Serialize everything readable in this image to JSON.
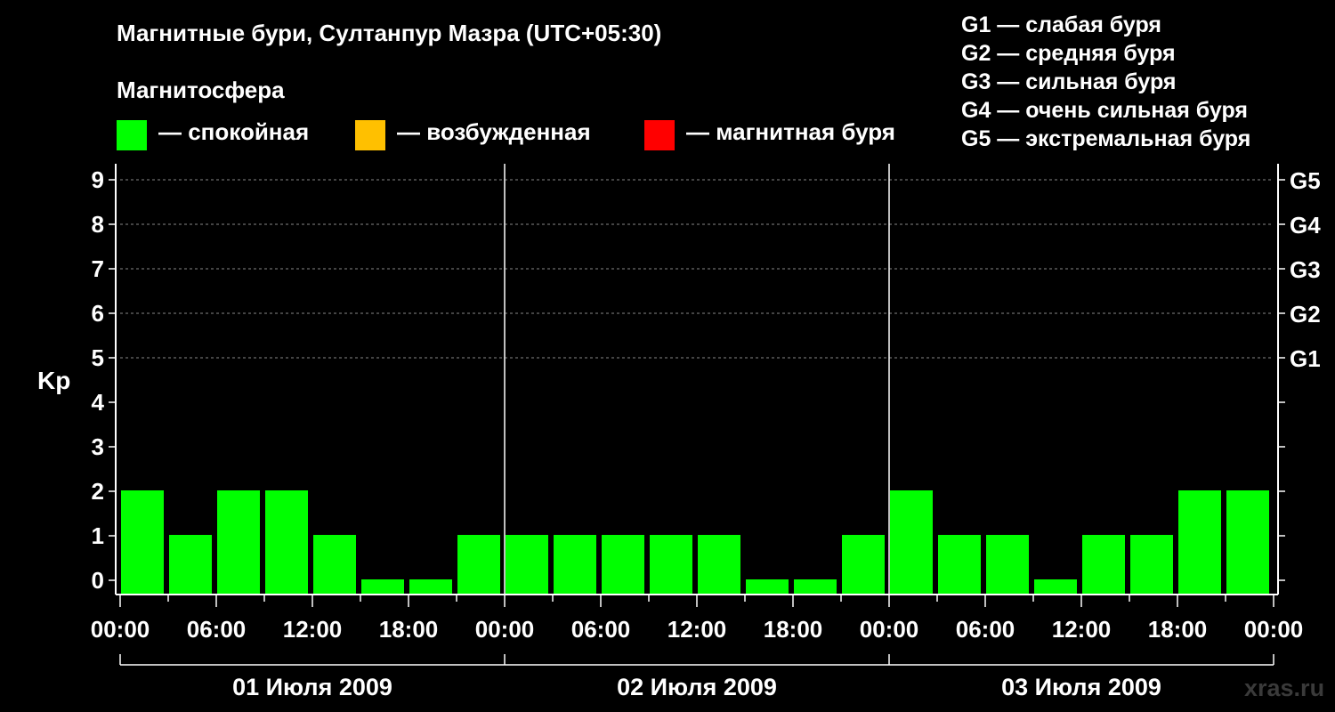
{
  "header": {
    "title": "Магнитные бури, Султанпур Мазра (UTC+05:30)",
    "legend_title": "Магнитосфера",
    "legend": [
      {
        "label": "— спокойная",
        "color": "#00ff00"
      },
      {
        "label": "— возбужденная",
        "color": "#ffc000"
      },
      {
        "label": "— магнитная буря",
        "color": "#ff0000"
      }
    ],
    "g_scale": [
      "G1 — слабая буря",
      "G2 — средняя буря",
      "G3 — сильная буря",
      "G4 — очень сильная буря",
      "G5 — экстремальная буря"
    ]
  },
  "watermark": "xras.ru",
  "chart_data": {
    "type": "bar",
    "ylabel": "Kp",
    "ylim": [
      0,
      9
    ],
    "y_ticks": [
      "0",
      "1",
      "2",
      "3",
      "4",
      "5",
      "6",
      "7",
      "8",
      "9"
    ],
    "g_ticks": [
      {
        "kp": 5,
        "label": "G1"
      },
      {
        "kp": 6,
        "label": "G2"
      },
      {
        "kp": 7,
        "label": "G3"
      },
      {
        "kp": 8,
        "label": "G4"
      },
      {
        "kp": 9,
        "label": "G5"
      }
    ],
    "x_tick_labels": [
      "00:00",
      "06:00",
      "12:00",
      "18:00",
      "00:00",
      "06:00",
      "12:00",
      "18:00",
      "00:00",
      "06:00",
      "12:00",
      "18:00",
      "00:00"
    ],
    "days": [
      "01 Июля 2009",
      "02 Июля 2009",
      "03 Июля 2009"
    ],
    "interval_hours": 3,
    "quiet_color": "#00ff00",
    "values": [
      2,
      1,
      2,
      2,
      1,
      0,
      0,
      1,
      1,
      1,
      1,
      1,
      1,
      0,
      0,
      1,
      2,
      1,
      1,
      0,
      1,
      1,
      2,
      2
    ]
  }
}
